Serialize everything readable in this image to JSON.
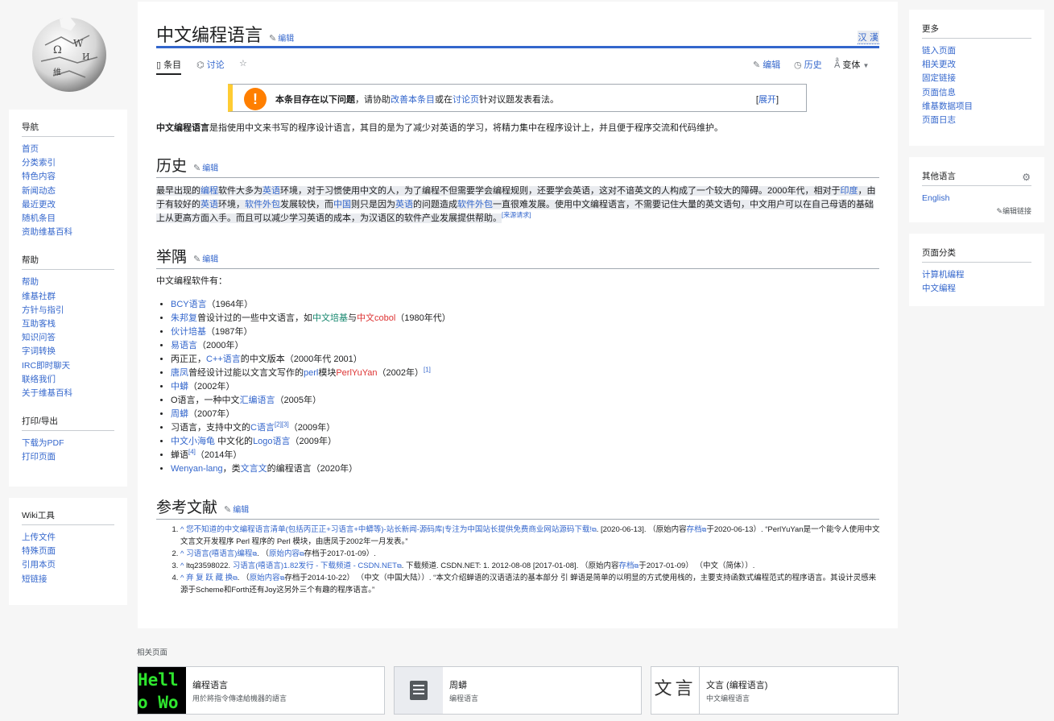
{
  "sidebar": {
    "nav_heading": "导航",
    "nav": [
      "首页",
      "分类索引",
      "特色内容",
      "新闻动态",
      "最近更改",
      "随机条目",
      "资助维基百科"
    ],
    "help_heading": "帮助",
    "help": [
      "帮助",
      "维基社群",
      "方针与指引",
      "互助客栈",
      "知识问答",
      "字词转换",
      "IRC即时聊天",
      "联络我们",
      "关于维基百科"
    ],
    "print_heading": "打印/导出",
    "print": [
      "下载为PDF",
      "打印页面"
    ],
    "tools_heading": "Wiki工具",
    "tools": [
      "上传文件",
      "特殊页面",
      "引用本页",
      "短链接"
    ]
  },
  "page": {
    "title": "中文编程语言",
    "edit": "编辑",
    "lang_variants": "汉 漢",
    "tab_article": "条目",
    "tab_talk": "讨论",
    "tab_edit": "编辑",
    "tab_history": "历史",
    "tab_variants": "变体"
  },
  "ambox": {
    "bold": "本条目存在以下问题",
    "t1": "，请协助",
    "link1": "改善本条目",
    "t2": "或在",
    "link2": "讨论页",
    "t3": "针对议题发表看法。",
    "expand_open": "[",
    "expand": "展开",
    "expand_close": "]"
  },
  "intro": {
    "bold": "中文编程语言",
    "text": "是指使用中文来书写的程序设计语言，其目的是为了减少对英语的学习，将精力集中在程序设计上，并且便于程序交流和代码维护。"
  },
  "history": {
    "heading": "历史",
    "edit": "编辑",
    "p": [
      "最早出现的",
      "编程",
      "软件大多为",
      "英语",
      "环境，对于习惯使用中文的人，为了编程不但需要学会编程规则，还要学会英语，这对不谙英文的人构成了一个较大的障碍。2000年代，相对于",
      "印度",
      "，由于有较好的",
      "英语",
      "环境，",
      "软件外包",
      "发展较快，而",
      "中国",
      "则只是因为",
      "英语",
      "的问题造成",
      "软件外包",
      "一直很难发展。使用中文编程语言，不需要记住大量的英文语句，中文用户可以在自己母语的基础上从更高方面入手。而且可以减少学习英语的成本，为汉语区的软件产业发展提供帮助。",
      "[来源请求]"
    ]
  },
  "examples": {
    "heading": "举隅",
    "edit": "编辑",
    "intro": "中文编程软件有：",
    "items": [
      [
        "BCY语言",
        "（1964年）"
      ],
      [
        "朱邦复",
        "曾设计过的一些中文语言，如",
        "中文培基",
        "与",
        "中文cobol",
        "（1980年代）"
      ],
      [
        "伙计培基",
        "（1987年）"
      ],
      [
        "易语言",
        "（2000年）"
      ],
      [
        "丙正正，",
        "C++语言",
        "的中文版本（2000年代 2001）"
      ],
      [
        "唐凤",
        "曾经设计过能以文言文写作的",
        "perl",
        "模块",
        "PerlYuYan",
        "（2002年）",
        "[1]"
      ],
      [
        "中蟒",
        "（2002年）"
      ],
      [
        "O语言，一种中文",
        "汇编语言",
        "（2005年）"
      ],
      [
        "周蟒",
        "（2007年）"
      ],
      [
        "习语言，支持中文的",
        "C语言",
        "[2][3]",
        "（2009年）"
      ],
      [
        "中文小海龟",
        " 中文化的",
        "Logo语言",
        "（2009年）"
      ],
      [
        "蝉语",
        "[4]",
        "（2014年）"
      ],
      [
        "Wenyan-lang",
        "，类",
        "文言文",
        "的编程语言（2020年）"
      ]
    ]
  },
  "references": {
    "heading": "参考文献",
    "edit": "编辑",
    "items": [
      [
        "^",
        "您不知道的中文编程语言清单(包括丙正正+习语言+中蟒等)-站长新闻-源码库|专注为中国站长提供免费商业网站源码下载!",
        ". [2020-06-13]. （原始内容",
        "存档",
        "于2020-06-13）. “PerlYuYan是一个能令人使用中文文言文开发程序 Perl 程序的 Perl 模块，由唐凤于2002年一月发表。”"
      ],
      [
        "^",
        "习语言(嘻语言)编程",
        ". （",
        "原始内容",
        "存档于2017-01-09）."
      ],
      [
        "^",
        "ltq23598022. ",
        "习语言(嘻语言)1.82发行 - 下载频道 - CSDN.NET",
        ". 下载频道. CSDN.NET: 1. 2012-08-08 [2017-01-08]. （原始内容",
        "存档",
        "于2017-01-09） （中文（简体））."
      ],
      [
        "^",
        "弃 复 跃 藏 换",
        ". （",
        "原始内容",
        "存档于2014-10-22） （中文（中国大陆））. “本文介绍蝉语的汉语语法的基本部分 引 蝉语是简单的以明显的方式使用栈的，主要支持函数式编程范式的程序语言。其设计灵感来源于Scheme和Forth还有Joy这另外三个有趣的程序语言。”"
      ]
    ]
  },
  "right": {
    "more_heading": "更多",
    "more": [
      "链入页面",
      "相关更改",
      "固定链接",
      "页面信息",
      "维基数据项目",
      "页面日志"
    ],
    "lang_heading": "其他语言",
    "lang": [
      "English"
    ],
    "edit_links": "编辑链接",
    "cat_heading": "页面分类",
    "cats": [
      "计算机编程",
      "中文编程"
    ]
  },
  "related": {
    "heading": "相关页面",
    "cards": [
      {
        "title": "编程语言",
        "desc": "用於將指令傳達給機器的語言",
        "thumb_text": "Hello World"
      },
      {
        "title": "周蟒",
        "desc": "编程语言",
        "thumb_text": ""
      },
      {
        "title": "文言 (编程语言)",
        "desc": "中文编程语言",
        "thumb_text": "文言"
      }
    ]
  }
}
